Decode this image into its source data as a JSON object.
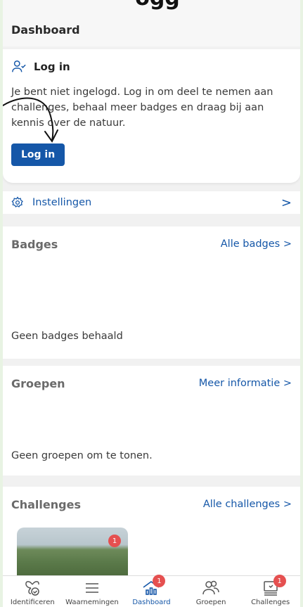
{
  "top": {
    "cut_text": "ogg"
  },
  "header": {
    "title": "Dashboard"
  },
  "login_card": {
    "title": "Log in",
    "text": "Je bent niet ingelogd. Log in om deel te nemen aan challenges, behaal meer badges en draag bij aan kennis over de natuur.",
    "button": "Log in"
  },
  "settings": {
    "label": "Instellingen",
    "chevron": ">"
  },
  "badges": {
    "title": "Badges",
    "link": "Alle badges >",
    "empty": "Geen badges behaald"
  },
  "groups": {
    "title": "Groepen",
    "link": "Meer informatie >",
    "empty": "Geen groepen om te tonen."
  },
  "challenges": {
    "title": "Challenges",
    "link": "Alle challenges >",
    "card_badge": "1"
  },
  "nav": {
    "items": [
      {
        "label": "Identificeren",
        "icon": "butterfly-check-icon",
        "badge": ""
      },
      {
        "label": "Waarnemingen",
        "icon": "list-icon",
        "badge": ""
      },
      {
        "label": "Dashboard",
        "icon": "dashboard-icon",
        "badge": "1"
      },
      {
        "label": "Groepen",
        "icon": "groups-icon",
        "badge": ""
      },
      {
        "label": "Challenges",
        "icon": "challenges-icon",
        "badge": "1"
      }
    ]
  },
  "colors": {
    "accent": "#1557a8",
    "badge": "#e55050",
    "background": "#e8f3e3"
  }
}
